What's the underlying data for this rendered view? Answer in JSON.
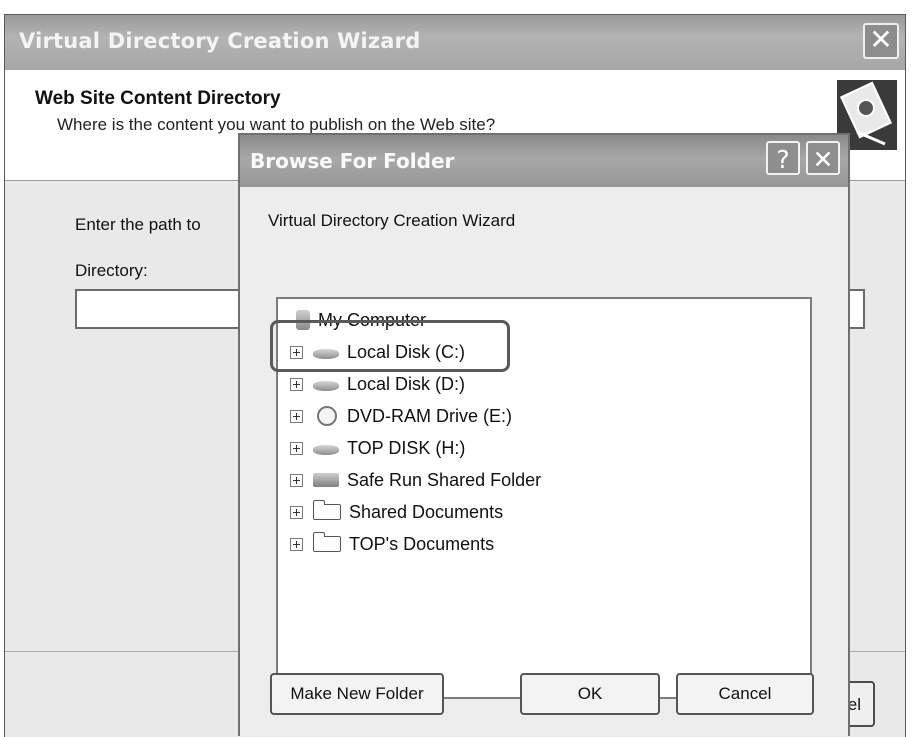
{
  "wizard": {
    "title": "Virtual Directory Creation Wizard",
    "heading": "Web Site Content Directory",
    "subheading": "Where is the content you want to publish on the Web site?",
    "path_label": "Enter the path to",
    "directory_label": "Directory:",
    "directory_value": "",
    "close_glyph": "✕",
    "cancel_label_partial": "el"
  },
  "dialog": {
    "title": "Browse For Folder",
    "help_glyph": "?",
    "close_glyph": "✕",
    "description": "Virtual Directory Creation Wizard",
    "tree": {
      "root": {
        "label": "My Computer",
        "icon": "computer-icon"
      },
      "items": [
        {
          "label": "Local Disk (C:)",
          "icon": "hard-disk-icon"
        },
        {
          "label": "Local Disk (D:)",
          "icon": "hard-disk-icon"
        },
        {
          "label": "DVD-RAM Drive (E:)",
          "icon": "dvd-drive-icon"
        },
        {
          "label": "TOP DISK (H:)",
          "icon": "hard-disk-icon"
        },
        {
          "label": "Safe Run Shared Folder",
          "icon": "shared-folder-icon"
        },
        {
          "label": "Shared Documents",
          "icon": "folder-icon"
        },
        {
          "label": "TOP's Documents",
          "icon": "folder-icon"
        }
      ]
    },
    "buttons": {
      "make_new_folder": "Make New Folder",
      "ok": "OK",
      "cancel": "Cancel"
    }
  },
  "colors": {
    "titlebar": "#a0a0a0",
    "window_bg": "#e9e9e9"
  }
}
